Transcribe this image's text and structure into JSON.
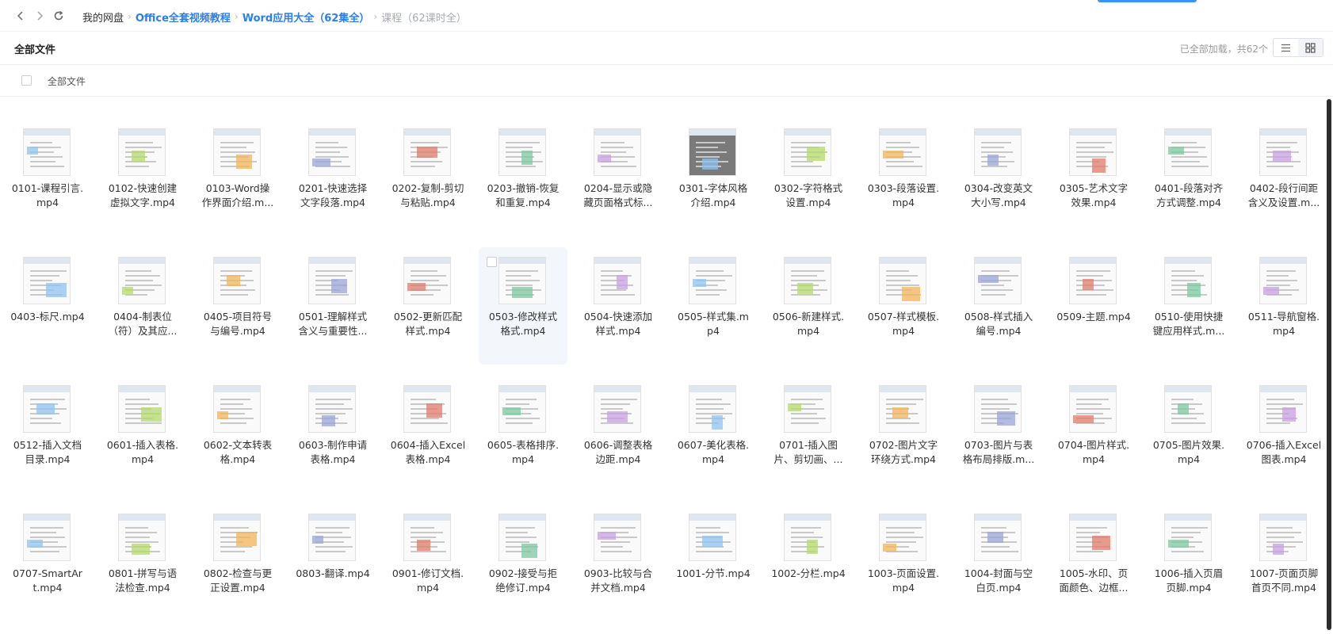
{
  "breadcrumb": {
    "root": "我的网盘",
    "items": [
      "Office全套视频教程",
      "Word应用大全（62集全）"
    ],
    "current": "课程（62课时全）"
  },
  "title": "全部文件",
  "load_status": "已全部加载，共62个",
  "header": {
    "select_all_label": "全部文件"
  },
  "view_modes": [
    "list-icon",
    "grid-icon"
  ],
  "files": [
    {
      "line1": "0101-课程引言.",
      "line2": "mp4"
    },
    {
      "line1": "0102-快速创建",
      "line2": "虚拟文字.mp4"
    },
    {
      "line1": "0103-Word操",
      "line2": "作界面介绍.m..."
    },
    {
      "line1": "0201-快速选择",
      "line2": "文字段落.mp4"
    },
    {
      "line1": "0202-复制-剪切",
      "line2": "与粘贴.mp4"
    },
    {
      "line1": "0203-撤销-恢复",
      "line2": "和重复.mp4"
    },
    {
      "line1": "0204-显示或隐",
      "line2": "藏页面格式标..."
    },
    {
      "line1": "0301-字体风格",
      "line2": "介绍.mp4"
    },
    {
      "line1": "0302-字符格式",
      "line2": "设置.mp4"
    },
    {
      "line1": "0303-段落设置.",
      "line2": "mp4"
    },
    {
      "line1": "0304-改变英文",
      "line2": "大小写.mp4"
    },
    {
      "line1": "0305-艺术文字",
      "line2": "效果.mp4"
    },
    {
      "line1": "0401-段落对齐",
      "line2": "方式调整.mp4"
    },
    {
      "line1": "0402-段行间距",
      "line2": "含义及设置.m..."
    },
    {
      "line1": "0403-标尺.mp4",
      "line2": ""
    },
    {
      "line1": "0404-制表位",
      "line2": "（符）及其应..."
    },
    {
      "line1": "0405-项目符号",
      "line2": "与编号.mp4"
    },
    {
      "line1": "0501-理解样式",
      "line2": "含义与重要性..."
    },
    {
      "line1": "0502-更新匹配",
      "line2": "样式.mp4"
    },
    {
      "line1": "0503-修改样式",
      "line2": "格式.mp4"
    },
    {
      "line1": "0504-快速添加",
      "line2": "样式.mp4"
    },
    {
      "line1": "0505-样式集.m",
      "line2": "p4"
    },
    {
      "line1": "0506-新建样式.",
      "line2": "mp4"
    },
    {
      "line1": "0507-样式模板.",
      "line2": "mp4"
    },
    {
      "line1": "0508-样式插入",
      "line2": "编号.mp4"
    },
    {
      "line1": "0509-主题.mp4",
      "line2": ""
    },
    {
      "line1": "0510-使用快捷",
      "line2": "键应用样式.m..."
    },
    {
      "line1": "0511-导航窗格.",
      "line2": "mp4"
    },
    {
      "line1": "0512-插入文档",
      "line2": "目录.mp4"
    },
    {
      "line1": "0601-插入表格.",
      "line2": "mp4"
    },
    {
      "line1": "0602-文本转表",
      "line2": "格.mp4"
    },
    {
      "line1": "0603-制作申请",
      "line2": "表格.mp4"
    },
    {
      "line1": "0604-插入Excel",
      "line2": "表格.mp4"
    },
    {
      "line1": "0605-表格排序.",
      "line2": "mp4"
    },
    {
      "line1": "0606-调整表格",
      "line2": "边距.mp4"
    },
    {
      "line1": "0607-美化表格.",
      "line2": "mp4"
    },
    {
      "line1": "0701-插入图",
      "line2": "片、剪切画、..."
    },
    {
      "line1": "0702-图片文字",
      "line2": "环绕方式.mp4"
    },
    {
      "line1": "0703-图片与表",
      "line2": "格布局排版.m..."
    },
    {
      "line1": "0704-图片样式.",
      "line2": "mp4"
    },
    {
      "line1": "0705-图片效果.",
      "line2": "mp4"
    },
    {
      "line1": "0706-插入Excel",
      "line2": "图表.mp4"
    },
    {
      "line1": "0707-SmartAr",
      "line2": "t.mp4"
    },
    {
      "line1": "0801-拼写与语",
      "line2": "法检查.mp4"
    },
    {
      "line1": "0802-检查与更",
      "line2": "正设置.mp4"
    },
    {
      "line1": "0803-翻译.mp4",
      "line2": ""
    },
    {
      "line1": "0901-修订文档.",
      "line2": "mp4"
    },
    {
      "line1": "0902-接受与拒",
      "line2": "绝修订.mp4"
    },
    {
      "line1": "0903-比较与合",
      "line2": "并文档.mp4"
    },
    {
      "line1": "1001-分节.mp4",
      "line2": ""
    },
    {
      "line1": "1002-分栏.mp4",
      "line2": ""
    },
    {
      "line1": "1003-页面设置.",
      "line2": "mp4"
    },
    {
      "line1": "1004-封面与空",
      "line2": "白页.mp4"
    },
    {
      "line1": "1005-水印、页",
      "line2": "面颜色、边框..."
    },
    {
      "line1": "1006-插入页眉",
      "line2": "页脚.mp4"
    },
    {
      "line1": "1007-页面页脚",
      "line2": "首页不同.mp4"
    }
  ]
}
